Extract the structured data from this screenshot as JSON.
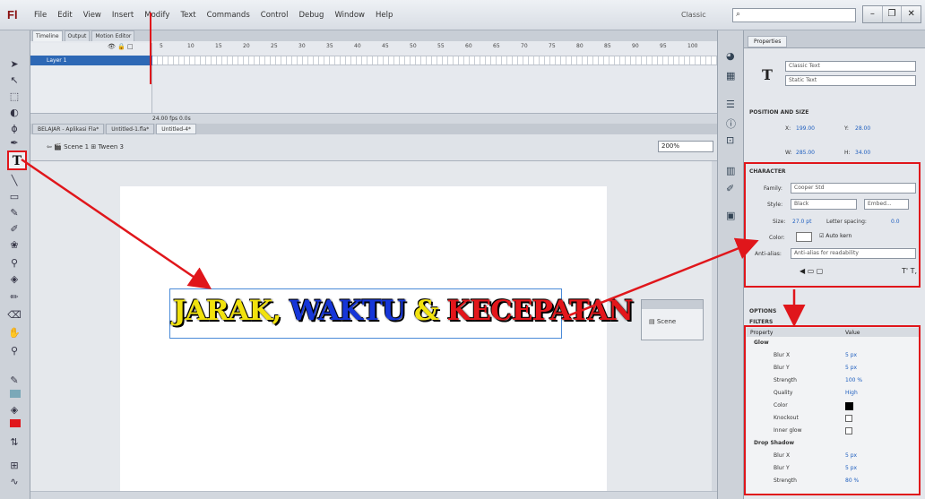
{
  "app": {
    "logo": "Fl",
    "menu": [
      "File",
      "Edit",
      "View",
      "Insert",
      "Modify",
      "Text",
      "Commands",
      "Control",
      "Debug",
      "Window",
      "Help"
    ],
    "workspace": "Classic"
  },
  "timeline": {
    "tabs": [
      "Timeline",
      "Output",
      "Motion Editor"
    ],
    "ruler": [
      "5",
      "10",
      "15",
      "20",
      "25",
      "30",
      "35",
      "40",
      "45",
      "50",
      "55",
      "60",
      "65",
      "70",
      "75",
      "80",
      "85",
      "90",
      "95",
      "100"
    ],
    "layer_name": "Layer 1",
    "status": "24.00 fps  0.0s"
  },
  "document": {
    "tabs": [
      "BELAJAR - Aplikasi Fla*",
      "Untitled-1.fla*",
      "Untitled-4*"
    ],
    "breadcrumb": [
      "Scene 1",
      "Tween 3"
    ],
    "zoom": "200%"
  },
  "stage": {
    "headline": {
      "w1": "JARAK,",
      "w2": "WAKTU",
      "w3": "&",
      "w4": "KECEPATAN"
    },
    "scene_button": "Scene"
  },
  "properties": {
    "tab": "Properties",
    "text_engine": "Classic Text",
    "text_type": "Static Text",
    "position_size": {
      "title": "POSITION AND SIZE",
      "x_label": "X:",
      "x": "199.00",
      "y_label": "Y:",
      "y": "28.00",
      "w_label": "W:",
      "w": "285.00",
      "h_label": "H:",
      "h": "34.00"
    },
    "character": {
      "title": "CHARACTER",
      "family_label": "Family:",
      "family": "Cooper Std",
      "style_label": "Style:",
      "style": "Black",
      "embed": "Embed...",
      "size_label": "Size:",
      "size": "27.0 pt",
      "spacing_label": "Letter spacing:",
      "spacing": "0.0",
      "color_label": "Color:",
      "autokern": "Auto kern",
      "aa_label": "Anti-alias:",
      "aa": "Anti-alias for readability"
    },
    "options_title": "OPTIONS",
    "filters": {
      "title": "FILTERS",
      "head_property": "Property",
      "head_value": "Value",
      "rows": [
        {
          "name": "Glow",
          "value": ""
        },
        {
          "name": "Blur X",
          "value": "5 px"
        },
        {
          "name": "Blur Y",
          "value": "5 px"
        },
        {
          "name": "Strength",
          "value": "100 %"
        },
        {
          "name": "Quality",
          "value": "High"
        },
        {
          "name": "Color",
          "value": ""
        },
        {
          "name": "Knockout",
          "value": ""
        },
        {
          "name": "Inner glow",
          "value": ""
        },
        {
          "name": "Drop Shadow",
          "value": ""
        },
        {
          "name": "Blur X",
          "value": "5 px"
        },
        {
          "name": "Blur Y",
          "value": "5 px"
        },
        {
          "name": "Strength",
          "value": "80 %"
        }
      ]
    }
  },
  "colors": {
    "highlight": "#e0161b",
    "headline_yellow": "#f1e20e",
    "headline_blue": "#1636d8",
    "headline_red": "#e3161b"
  }
}
